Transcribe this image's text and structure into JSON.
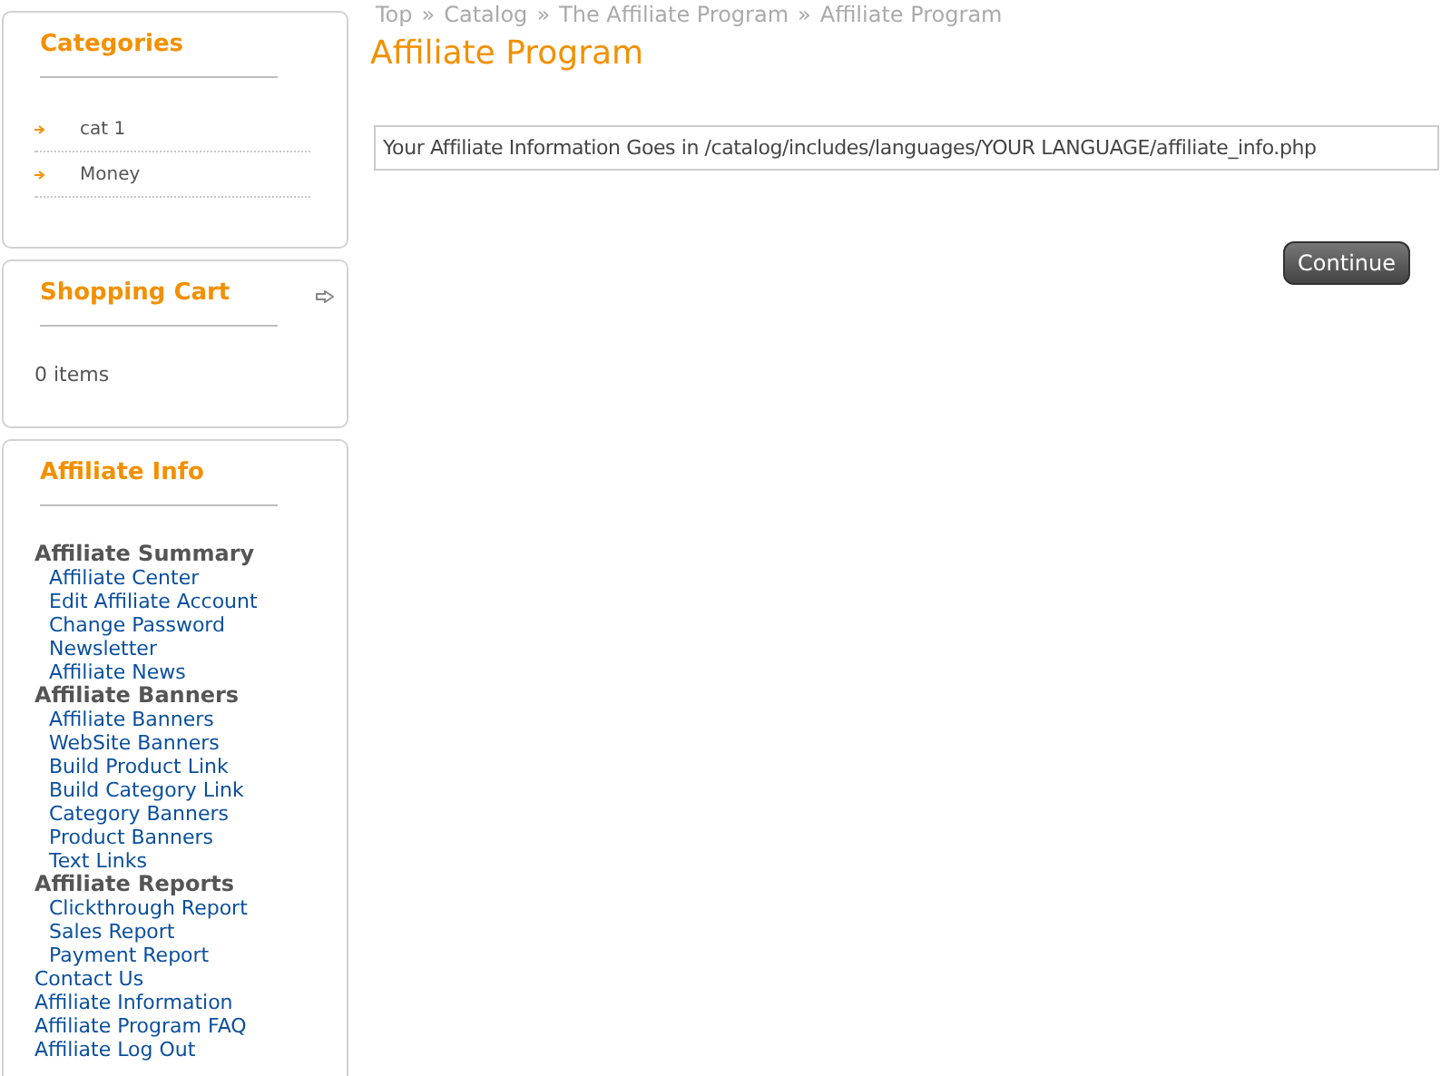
{
  "breadcrumb": {
    "separator": "»",
    "items": [
      "Top",
      "Catalog",
      "The Affiliate Program",
      "Affiliate Program"
    ]
  },
  "sidebar": {
    "boxes": [
      {
        "kind": "categories",
        "title": "Categories",
        "items": [
          "cat 1",
          "Money"
        ]
      },
      {
        "kind": "cart",
        "title": "Shopping Cart",
        "text": "0 items"
      },
      {
        "kind": "affiliate",
        "title": "Affiliate Info",
        "items": [
          {
            "label": "Affiliate Summary",
            "children": [
              "Affiliate Center",
              "Edit Affiliate Account",
              "Change Password",
              "Newsletter",
              "Affiliate News"
            ]
          },
          {
            "label": "Affiliate Banners",
            "children": [
              "Affiliate Banners",
              "WebSite Banners",
              "Build Product Link",
              "Build Category Link",
              "Category Banners",
              "Product Banners",
              "Text Links"
            ]
          },
          {
            "label": "Affiliate Reports",
            "children": [
              "Clickthrough Report",
              "Sales Report",
              "Payment Report"
            ]
          },
          {
            "label": "Contact Us"
          },
          {
            "label": "Affiliate Information"
          },
          {
            "label": "Affiliate Program FAQ"
          },
          {
            "label": "Affiliate Log Out"
          }
        ]
      }
    ]
  },
  "main": {
    "title": "Affiliate Program",
    "info": "Your Affiliate Information Goes in /catalog/includes/languages/YOUR LANGUAGE/affiliate_info.php",
    "button": "Continue"
  }
}
